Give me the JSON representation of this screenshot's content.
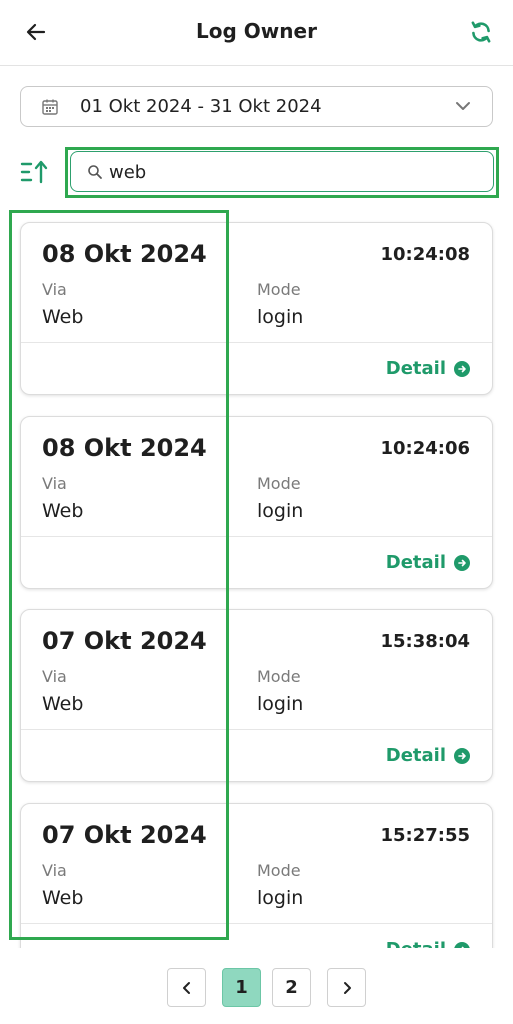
{
  "header": {
    "title": "Log Owner"
  },
  "date_range": {
    "value": "01 Okt 2024 - 31 Okt 2024"
  },
  "search": {
    "value": "web"
  },
  "labels": {
    "via": "Via",
    "mode": "Mode",
    "detail": "Detail"
  },
  "entries": [
    {
      "date": "08 Okt 2024",
      "time": "10:24:08",
      "via": "Web",
      "mode": "login"
    },
    {
      "date": "08 Okt 2024",
      "time": "10:24:06",
      "via": "Web",
      "mode": "login"
    },
    {
      "date": "07 Okt 2024",
      "time": "15:38:04",
      "via": "Web",
      "mode": "login"
    },
    {
      "date": "07 Okt 2024",
      "time": "15:27:55",
      "via": "Web",
      "mode": "login"
    }
  ],
  "pagination": {
    "pages": [
      "1",
      "2"
    ],
    "current": "1"
  },
  "colors": {
    "accent": "#1f9a6a",
    "highlight": "#2fa84f",
    "active_page": "#8fd8bf"
  }
}
